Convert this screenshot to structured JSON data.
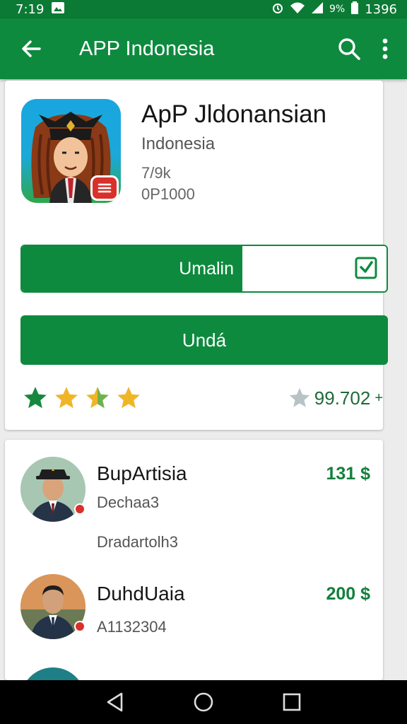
{
  "status_bar": {
    "time": "7:19",
    "battery_text": "9%",
    "clock_right": "1396"
  },
  "app_bar": {
    "title": "APP Indonesia"
  },
  "app": {
    "name": "ApP Jldonansian",
    "developer": "Indonesia",
    "size": "7/9k",
    "downloads": "0P1000"
  },
  "buttons": {
    "uninstall": "Umalin",
    "update": "Undá"
  },
  "rating": {
    "stars": 4,
    "value": "99.702",
    "suffix": "+"
  },
  "items": [
    {
      "name": "BupArtisia",
      "sub1": "Dechaa3",
      "sub2": "Dradartolh3",
      "price": "131 $"
    },
    {
      "name": "DuhdUaia",
      "sub1": "A1132304",
      "price": "200 $"
    }
  ],
  "colors": {
    "primary": "#0e8a3e",
    "status_bar": "#0b7a34",
    "star_green": "#16883d",
    "star_gold": "#f0b527",
    "badge_red": "#d9302b"
  }
}
